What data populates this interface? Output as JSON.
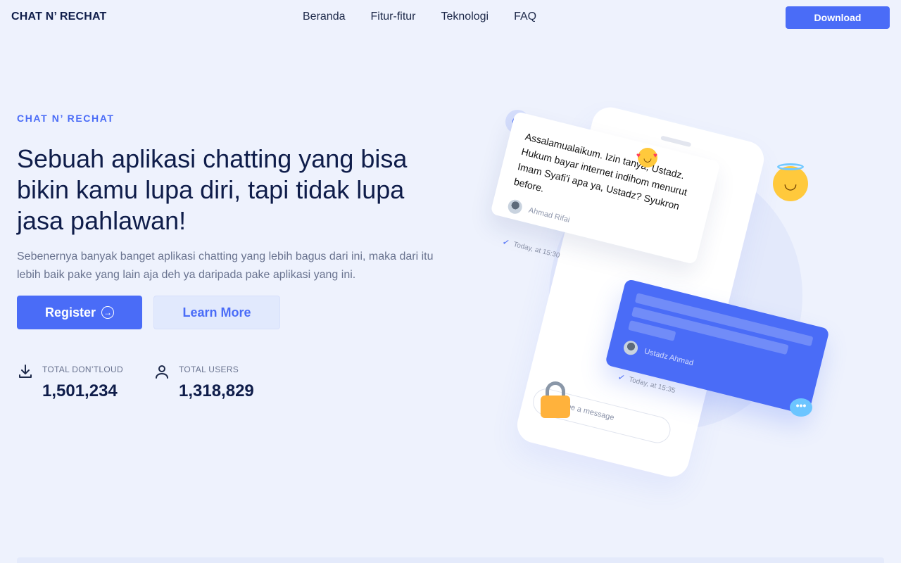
{
  "header": {
    "logo": "CHAT N’ RECHAT",
    "nav": [
      "Beranda",
      "Fitur-fitur",
      "Teknologi",
      "FAQ"
    ],
    "download_label": "Download"
  },
  "hero": {
    "eyebrow": "CHAT N’ RECHAT",
    "headline": "Sebuah aplikasi chatting yang bisa bikin kamu lupa diri, tapi tidak lupa jasa pahlawan!",
    "subtext": "Sebenernya banyak banget aplikasi chatting yang lebih bagus dari ini, maka dari itu lebih baik pake yang lain aja deh ya daripada pake aplikasi yang ini.",
    "register_label": "Register",
    "learn_more_label": "Learn More",
    "stats": [
      {
        "label": "TOTAL DON’TLOUD",
        "value": "1,501,234",
        "icon": "download-icon"
      },
      {
        "label": "TOTAL USERS",
        "value": "1,318,829",
        "icon": "user-icon"
      }
    ]
  },
  "illustration": {
    "incoming_message": "Assalamualaikum. Izin tanya, Ustadz. Hukum bayar internet indihom menurut Imam Syafi'i apa ya, Ustadz? Syukron before.",
    "incoming_author": "Ahmad Rifai",
    "incoming_time": "Today, at 15:30",
    "reply_author": "Ustadz Ahmad",
    "reply_time": "Today, at 15:35",
    "input_placeholder": "Type a message"
  },
  "colors": {
    "accent": "#4a6cf7",
    "background": "#eef2fd",
    "text_dark": "#0f1d4a",
    "text_muted": "#6a7490"
  }
}
